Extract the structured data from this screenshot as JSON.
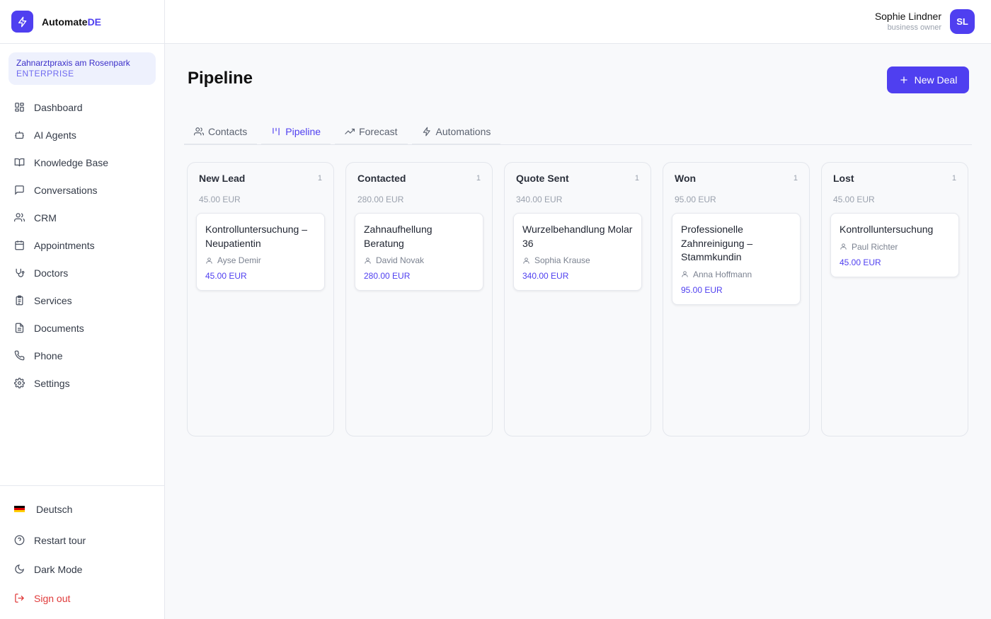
{
  "brand": {
    "name_main": "Automate",
    "name_accent": "DE"
  },
  "organization": {
    "name": "Zahnarztpraxis am Rosenpark",
    "plan": "ENTERPRISE"
  },
  "nav": [
    {
      "label": "Dashboard",
      "icon": "dashboard-icon"
    },
    {
      "label": "AI Agents",
      "icon": "bot-icon"
    },
    {
      "label": "Knowledge Base",
      "icon": "book-icon"
    },
    {
      "label": "Conversations",
      "icon": "chat-icon"
    },
    {
      "label": "CRM",
      "icon": "users-icon"
    },
    {
      "label": "Appointments",
      "icon": "calendar-icon"
    },
    {
      "label": "Doctors",
      "icon": "stethoscope-icon"
    },
    {
      "label": "Services",
      "icon": "clipboard-icon"
    },
    {
      "label": "Documents",
      "icon": "document-icon"
    },
    {
      "label": "Phone",
      "icon": "phone-icon"
    },
    {
      "label": "Settings",
      "icon": "gear-icon"
    }
  ],
  "bottom": {
    "language": "Deutsch",
    "restart_tour": "Restart tour",
    "dark_mode": "Dark Mode",
    "sign_out": "Sign out"
  },
  "user": {
    "name": "Sophie Lindner",
    "role": "business owner",
    "initials": "SL"
  },
  "page": {
    "title": "Pipeline",
    "new_deal_label": "New Deal"
  },
  "tabs": [
    {
      "label": "Contacts",
      "icon": "users-icon",
      "active": false
    },
    {
      "label": "Pipeline",
      "icon": "pipeline-icon",
      "active": true
    },
    {
      "label": "Forecast",
      "icon": "trend-icon",
      "active": false
    },
    {
      "label": "Automations",
      "icon": "bolt-icon",
      "active": false
    }
  ],
  "columns": [
    {
      "title": "New Lead",
      "count": "1",
      "total": "45.00 EUR",
      "cards": [
        {
          "title": "Kontrolluntersuchung – Neupatientin",
          "contact": "Ayse Demir",
          "value": "45.00 EUR"
        }
      ]
    },
    {
      "title": "Contacted",
      "count": "1",
      "total": "280.00 EUR",
      "cards": [
        {
          "title": "Zahnaufhellung Beratung",
          "contact": "David Novak",
          "value": "280.00 EUR"
        }
      ]
    },
    {
      "title": "Quote Sent",
      "count": "1",
      "total": "340.00 EUR",
      "cards": [
        {
          "title": "Wurzelbehandlung Molar 36",
          "contact": "Sophia Krause",
          "value": "340.00 EUR"
        }
      ]
    },
    {
      "title": "Won",
      "count": "1",
      "total": "95.00 EUR",
      "cards": [
        {
          "title": "Professionelle Zahnreinigung – Stammkundin",
          "contact": "Anna Hoffmann",
          "value": "95.00 EUR"
        }
      ]
    },
    {
      "title": "Lost",
      "count": "1",
      "total": "45.00 EUR",
      "cards": [
        {
          "title": "Kontrolluntersuchung",
          "contact": "Paul Richter",
          "value": "45.00 EUR"
        }
      ]
    }
  ],
  "colors": {
    "accent": "#4f3ff0",
    "danger": "#e03a3a"
  }
}
